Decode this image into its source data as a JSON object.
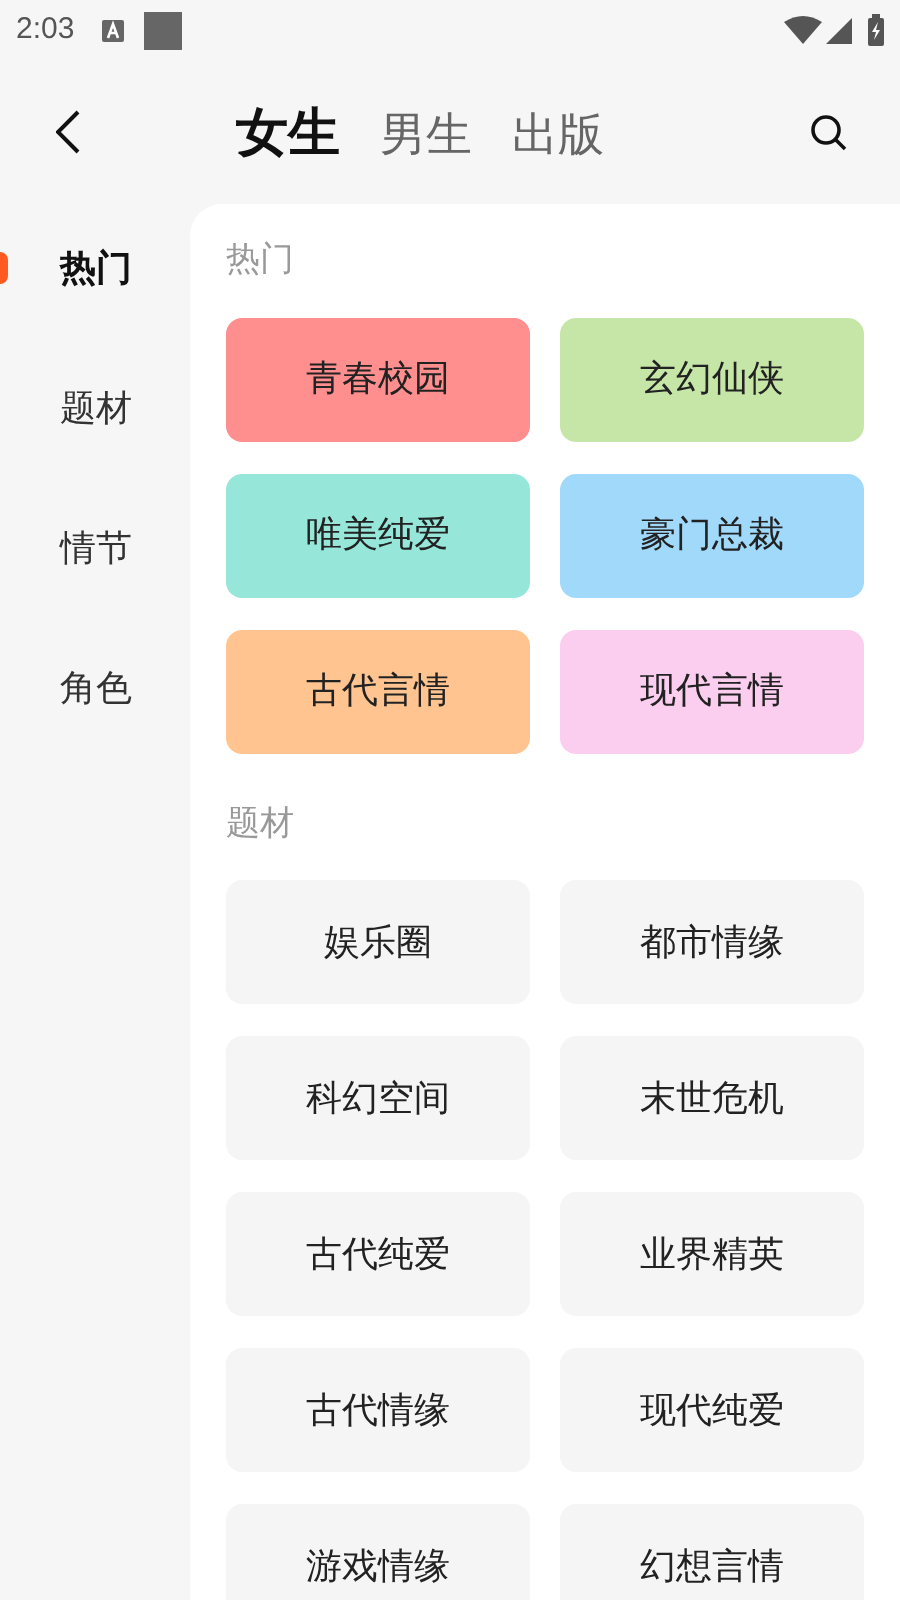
{
  "status_bar": {
    "time": "2:03"
  },
  "tabs": [
    {
      "label": "女生",
      "selected": true
    },
    {
      "label": "男生",
      "selected": false
    },
    {
      "label": "出版",
      "selected": false
    }
  ],
  "sidebar": {
    "items": [
      {
        "label": "热门",
        "selected": true
      },
      {
        "label": "题材",
        "selected": false
      },
      {
        "label": "情节",
        "selected": false
      },
      {
        "label": "角色",
        "selected": false
      }
    ]
  },
  "sections": [
    {
      "title": "热门",
      "items": [
        {
          "label": "青春校园",
          "color": "#ff8f8f"
        },
        {
          "label": "玄幻仙侠",
          "color": "#c6e6a7"
        },
        {
          "label": "唯美纯爱",
          "color": "#96e6d9"
        },
        {
          "label": "豪门总裁",
          "color": "#a1d9fb"
        },
        {
          "label": "古代言情",
          "color": "#ffc48f"
        },
        {
          "label": "现代言情",
          "color": "#fbcdef"
        }
      ]
    },
    {
      "title": "题材",
      "items": [
        {
          "label": "娱乐圈"
        },
        {
          "label": "都市情缘"
        },
        {
          "label": "科幻空间"
        },
        {
          "label": "末世危机"
        },
        {
          "label": "古代纯爱"
        },
        {
          "label": "业界精英"
        },
        {
          "label": "古代情缘"
        },
        {
          "label": "现代纯爱"
        },
        {
          "label": "游戏情缘"
        },
        {
          "label": "幻想言情"
        }
      ]
    }
  ]
}
